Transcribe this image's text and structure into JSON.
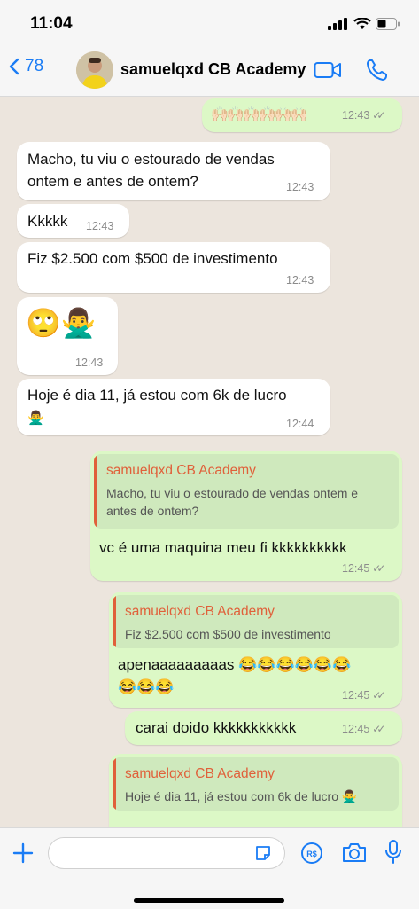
{
  "status": {
    "time": "11:04"
  },
  "header": {
    "back_count": "78",
    "contact_name": "samuelqxd CB Academy"
  },
  "messages": [
    {
      "dir": "out",
      "text": "🙌🏻🙌🏻🙌🏻🙌🏻🙌🏻🙌🏻",
      "time": "12:43"
    },
    {
      "dir": "in",
      "text_line1": "Macho,  tu viu o estourado de vendas",
      "text_line2": "ontem e antes de ontem?",
      "time": "12:43"
    },
    {
      "dir": "in",
      "text": "Kkkkk",
      "time": "12:43"
    },
    {
      "dir": "in",
      "text": "Fiz $2.500 com $500 de investimento",
      "time": "12:43"
    },
    {
      "dir": "in",
      "text": "🙄🙅‍♂️",
      "time": "12:43"
    },
    {
      "dir": "in",
      "text_line1": "Hoje é dia 11, já estou com 6k de lucro",
      "text_line2": "🙅‍♂️",
      "time": "12:44"
    },
    {
      "dir": "out",
      "quote_name": "samuelqxd CB Academy",
      "quote_line1": "Macho,  tu viu o estourado de vendas ontem e",
      "quote_line2": "antes de ontem?",
      "text": "vc é uma maquina meu fi kkkkkkkkkk",
      "time": "12:45"
    },
    {
      "dir": "out",
      "quote_name": "samuelqxd CB Academy",
      "quote_line1": "Fiz $2.500 com $500 de investimento",
      "text_line1": "apenaaaaaaaaas 😂😂😂😂😂😂",
      "text_line2": "😂😂😂",
      "time": "12:45"
    },
    {
      "dir": "out",
      "text": "carai doido kkkkkkkkkkk",
      "time": "12:45"
    },
    {
      "dir": "out",
      "quote_name": "samuelqxd CB Academy",
      "quote_line1": "Hoje é dia 11, já estou com 6k de lucro 🙅‍♂️",
      "text": "",
      "time": ""
    }
  ],
  "colors": {
    "accent": "#1a7cf5",
    "outgoing": "#dcf8c6",
    "incoming": "#ffffff",
    "quote_name": "#e0603a"
  },
  "icons": [
    "back-chevron-icon",
    "video-call-icon",
    "phone-icon",
    "plus-icon",
    "sticker-icon",
    "payment-icon",
    "camera-icon",
    "microphone-icon"
  ]
}
